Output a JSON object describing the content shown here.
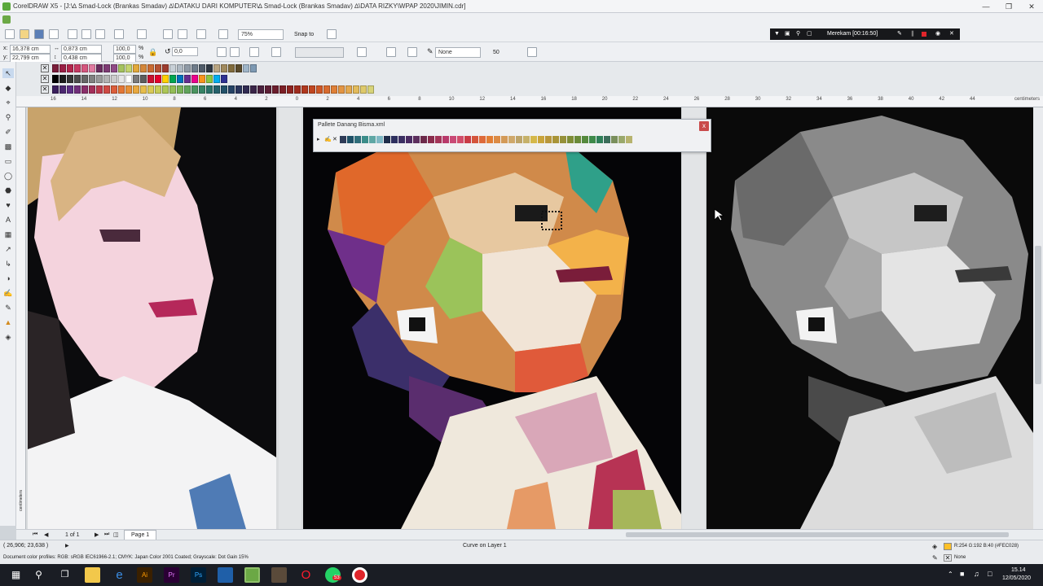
{
  "window": {
    "title": "CorelDRAW X5 - [J:\\∆ Smad-Lock (Brankas Smadav) ∆\\DATAKU DARI KOMPUTER\\∆ Smad-Lock (Brankas Smadav) ∆\\DATA RIZKY\\WPAP 2020\\JIMIN.cdr]"
  },
  "toolbar": {
    "zoom": "75%",
    "snap_to": "Snap to",
    "outline_width": "None",
    "nib_size": "50"
  },
  "recorder": {
    "label": "Merekam [00:16:50]"
  },
  "propbar": {
    "x": "16,378 cm",
    "y": "22,799 cm",
    "width": "0,873 cm",
    "height": "0,438 cm",
    "scale_w": "100,0",
    "scale_h": "100,0",
    "pct_w": "%",
    "pct_h": "%",
    "angle": "0,0"
  },
  "ruler": {
    "unit": "centimeters",
    "labels": [
      "16",
      "14",
      "12",
      "10",
      "8",
      "6",
      "4",
      "2",
      "0",
      "2",
      "4",
      "6",
      "8",
      "10",
      "12",
      "14",
      "16",
      "18",
      "20",
      "22",
      "24",
      "26",
      "28",
      "30",
      "32",
      "34",
      "36",
      "38",
      "40",
      "42",
      "44"
    ],
    "vertical_unit": "centimeters"
  },
  "dialog": {
    "title": "Pallete Danang Bisma.xml",
    "close": "x",
    "colors": [
      "#2e3b57",
      "#1e4f66",
      "#2f6d7a",
      "#3c8d8a",
      "#5fa7a5",
      "#7fb8c4",
      "#1f2d4a",
      "#2d2f5e",
      "#3b2f62",
      "#4b2c63",
      "#5d2f5e",
      "#6d2a4a",
      "#8a2c4c",
      "#a33457",
      "#b8396a",
      "#c94a76",
      "#d14d6a",
      "#c93b45",
      "#d4553c",
      "#de6a3a",
      "#e27e34",
      "#dc8b45",
      "#d39a58",
      "#cfa86b",
      "#bda46a",
      "#c6b16a",
      "#d5b84a",
      "#c9a43b",
      "#b8963a",
      "#a99437",
      "#96913a",
      "#7f8d36",
      "#6a8a38",
      "#568a3e",
      "#3e8a4a",
      "#2f7f58",
      "#3c6d5a",
      "#7a8f5c",
      "#9aa86b",
      "#b7b36e"
    ]
  },
  "palette_rows": [
    [
      "#7a1d3a",
      "#9a1f45",
      "#b3264d",
      "#c63a63",
      "#d5567e",
      "#e07aa0",
      "#6a2c5e",
      "#7d3a73",
      "#8f4a86",
      "#a4c25e",
      "#c3d46e",
      "#e2a93b",
      "#d4873a",
      "#c96b32",
      "#b45232",
      "#9c3c2e",
      "#c7cfd6",
      "#aeb8c2",
      "#8f9aa6",
      "#6f7c8a",
      "#4f5b68",
      "#2e3742",
      "#b9a582",
      "#a08a5e",
      "#806b3c",
      "#5a4a2a",
      "#9fb5c8",
      "#7d99b3"
    ],
    [
      "#000000",
      "#1b1b1b",
      "#353535",
      "#4d4d4d",
      "#666666",
      "#808080",
      "#999999",
      "#b3b3b3",
      "#cccccc",
      "#e6e6e6",
      "#ffffff",
      "#7a7a7a",
      "#5d5d5d",
      "#c8102e",
      "#e4002b",
      "#ffd100",
      "#00a651",
      "#0072bc",
      "#662d91",
      "#ec008c",
      "#f7941d",
      "#8dc63f",
      "#00aeef",
      "#2e3192"
    ],
    [
      "#3a1f5c",
      "#4b2870",
      "#5e2f84",
      "#712f7a",
      "#8a2f6a",
      "#a3305a",
      "#bd3a4d",
      "#cf4a44",
      "#db5e3b",
      "#e37736",
      "#e79138",
      "#e8a940",
      "#e6bd4c",
      "#d9c955",
      "#c6cc58",
      "#adc756",
      "#93bd56",
      "#79b257",
      "#60a45b",
      "#4a945f",
      "#378365",
      "#2b7269",
      "#25616b",
      "#235169",
      "#254264",
      "#2a355c",
      "#302b52",
      "#3a2548",
      "#4a213e",
      "#5b1f35",
      "#6b1e2d",
      "#7c1f26",
      "#8e2421",
      "#9f2c1e",
      "#b0381e",
      "#c04721",
      "#ce5827",
      "#d86b2f",
      "#df8038",
      "#e39543",
      "#e4a94f",
      "#e2bb5c",
      "#dec96a",
      "#d7d378"
    ]
  ],
  "page": {
    "count": "1 of 1",
    "tab": "Page 1"
  },
  "status": {
    "coords": "( 26,906; 23,638 )",
    "object": "Curve on Layer 1",
    "profiles": "Document color profiles: RGB: sRGB IEC61966-2.1; CMYK: Japan Color 2001 Coated; Grayscale: Dot Gain 15%",
    "fill": "R:254 G:192 B:40 (#FEC028)",
    "outline": "None"
  },
  "taskbar": {
    "time": "15.14",
    "date": "12/05/2020",
    "badge": "53"
  }
}
